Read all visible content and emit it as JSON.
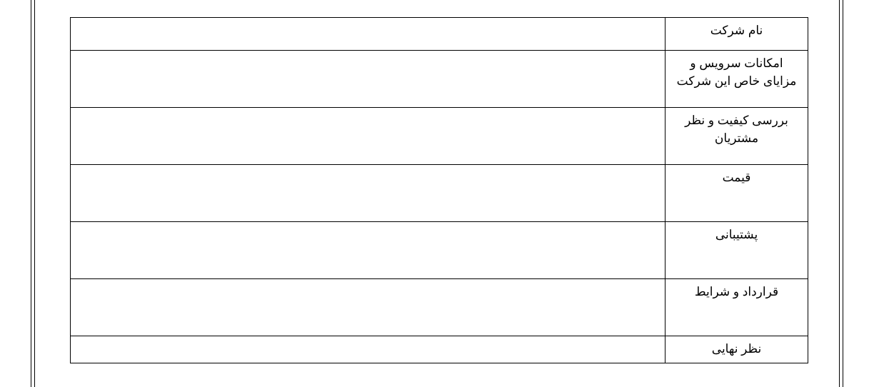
{
  "table": {
    "rows": [
      {
        "label": "نام شرکت",
        "value": ""
      },
      {
        "label": "امکانات سرویس و مزایای خاص این شرکت",
        "value": ""
      },
      {
        "label": "بررسی کیفیت و نظر مشتریان",
        "value": ""
      },
      {
        "label": "قیمت",
        "value": ""
      },
      {
        "label": "پشتیبانی",
        "value": ""
      },
      {
        "label": "قرارداد و شرایط",
        "value": ""
      },
      {
        "label": "نظر نهایی",
        "value": ""
      }
    ]
  }
}
